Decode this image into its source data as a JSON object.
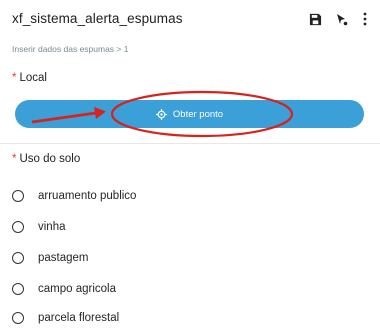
{
  "header": {
    "title": "xf_sistema_alerta_espumas",
    "actions": [
      {
        "icon": "save-icon"
      },
      {
        "icon": "location-pin-icon"
      },
      {
        "icon": "more-vertical-icon"
      }
    ]
  },
  "breadcrumb": "Inserir dados das espumas > 1",
  "local": {
    "required_mark": "*",
    "label": "Local",
    "button_label": "Obter ponto",
    "button_icon": "gps-target-icon"
  },
  "uso_solo": {
    "required_mark": "*",
    "label": "Uso do solo",
    "options": [
      "arruamento publico",
      "vinha",
      "pastagem",
      "campo agricola",
      "parcela florestal"
    ]
  },
  "colors": {
    "button": "#3b9fd8",
    "required": "#e53935",
    "annotation": "#d9221c"
  }
}
